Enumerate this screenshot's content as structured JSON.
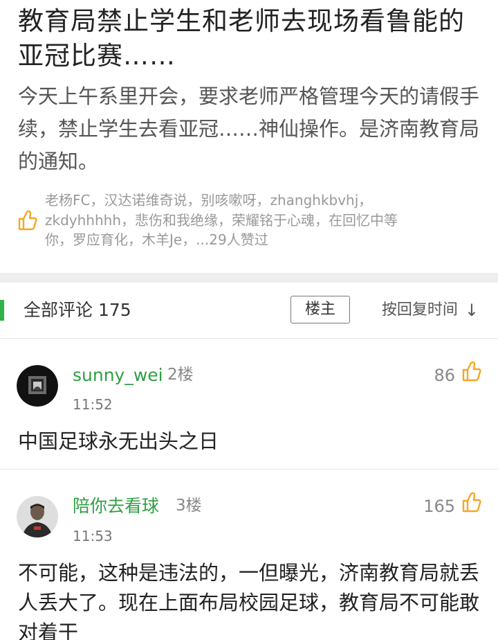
{
  "post": {
    "title": "教育局禁止学生和老师去现场看鲁能的亚冠比赛……",
    "body": "今天上午系里开会，要求老师严格管理今天的请假手续，禁止学生去看亚冠……神仙操作。是济南教育局的通知。",
    "likes_line1": "老杨FC，汉达诺维奇说，别咳嗽呀，zhanghkbvhj，",
    "likes_line2": "zkdyhhhhh，悲伤和我绝缘，荣耀铭于心魂，在回忆中等",
    "likes_line3": "你，罗应育化，木羊Je，...29人赞过",
    "icon": "thumbs-up-icon"
  },
  "comments_header": {
    "title": "全部评论 175",
    "filter_label": "楼主",
    "sort_label": "按回复时间",
    "sort_icon": "↓",
    "accent_color": "#31b14a"
  },
  "comments": [
    {
      "author": "sunny_wei",
      "floor": "2楼",
      "time": "11:52",
      "likes": "86",
      "text": "中国足球永无出头之日",
      "avatar": "dark-photo-avatar"
    },
    {
      "author": "陪你去看球",
      "floor": "3楼",
      "time": "11:53",
      "likes": "165",
      "text": "不可能，这种是违法的，一但曝光，济南教育局就丢人丢大了。现在上面布局校园足球，教育局不可能敢对着干",
      "avatar": "player-photo-avatar"
    }
  ],
  "colors": {
    "author_green": "#2f9e43",
    "like_orange": "#f5a623"
  }
}
